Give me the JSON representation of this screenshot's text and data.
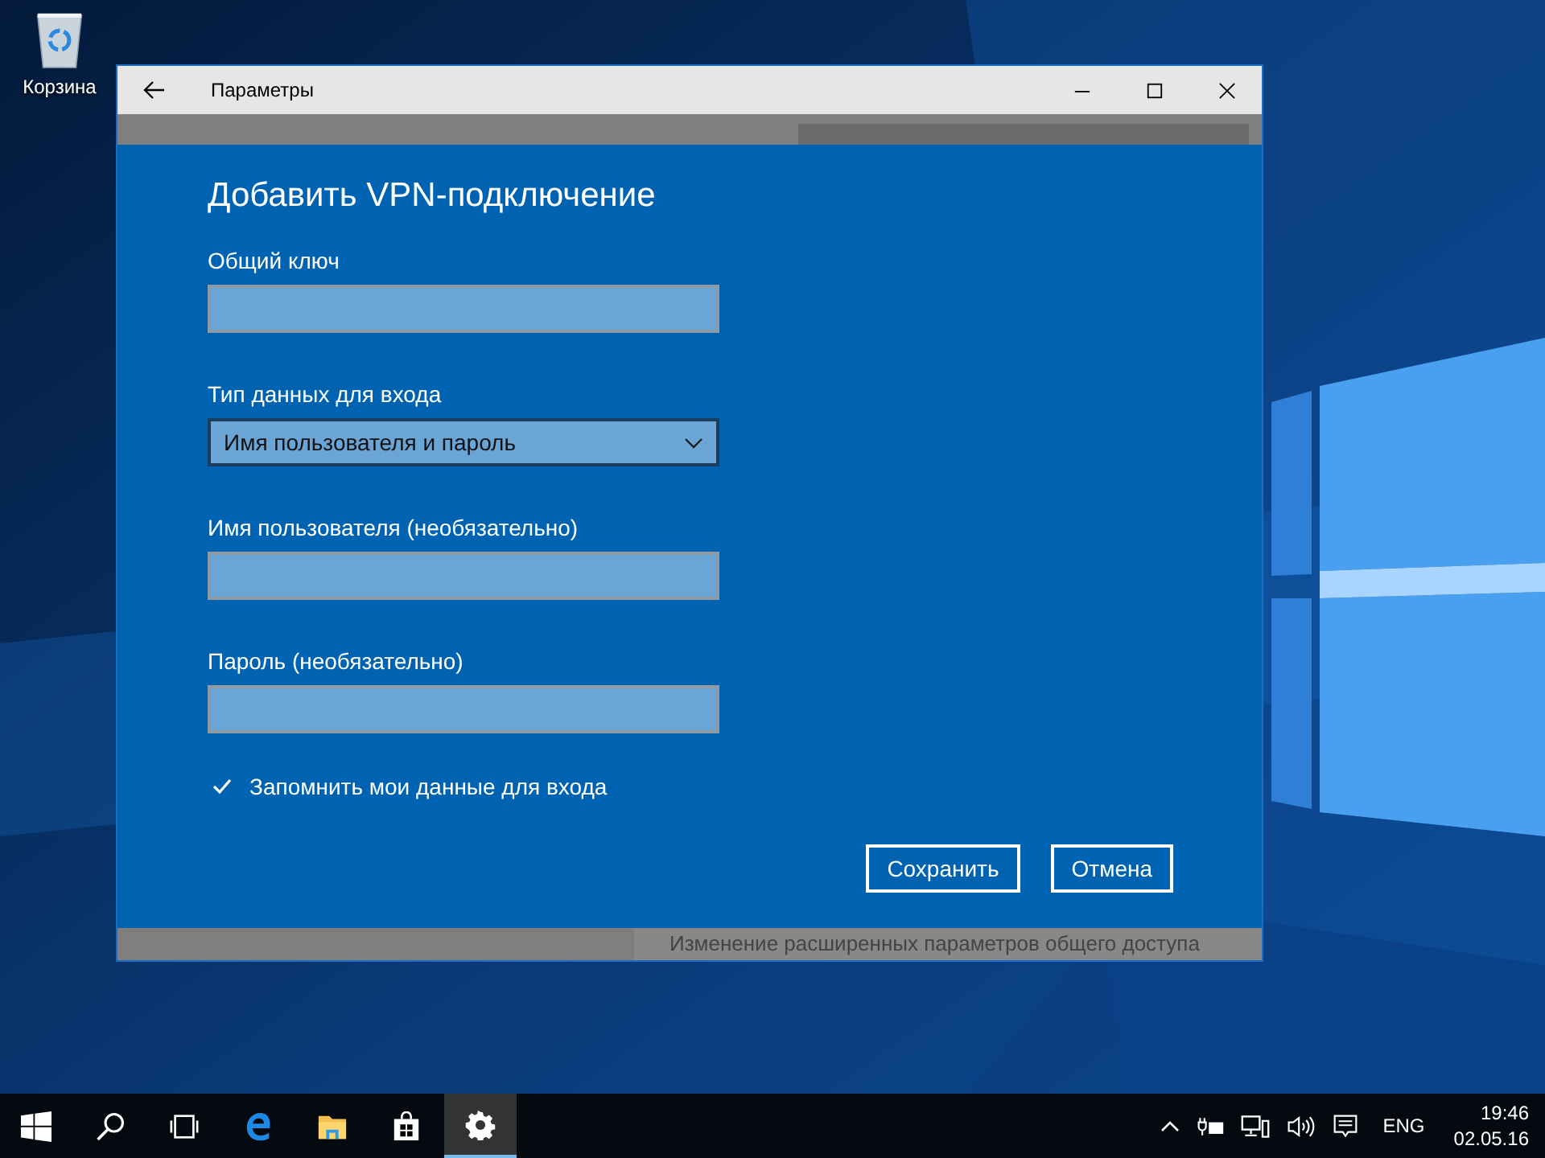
{
  "desktop": {
    "icons": [
      {
        "label": "Корзина"
      }
    ]
  },
  "window": {
    "title": "Параметры",
    "footer_text": "Изменение расширенных параметров общего доступа"
  },
  "dialog": {
    "title": "Добавить VPN-подключение",
    "fields": [
      {
        "kind": "text",
        "label": "Общий ключ"
      },
      {
        "kind": "select",
        "label": "Тип данных для входа",
        "value": "Имя пользователя и пароль"
      },
      {
        "kind": "text",
        "label": "Имя пользователя (необязательно)"
      },
      {
        "kind": "text",
        "label": "Пароль (необязательно)"
      }
    ],
    "checkbox": {
      "label": "Запомнить мои данные для входа",
      "checked": true
    },
    "buttons": [
      {
        "label": "Сохранить"
      },
      {
        "label": "Отмена"
      }
    ]
  },
  "taskbar": {
    "items": [
      {
        "kind": "start",
        "selected": false
      },
      {
        "kind": "search",
        "selected": false
      },
      {
        "kind": "taskview",
        "selected": false
      },
      {
        "kind": "browser",
        "selected": false
      },
      {
        "kind": "folder",
        "selected": false
      },
      {
        "kind": "store",
        "selected": false
      },
      {
        "kind": "settings",
        "selected": true
      }
    ],
    "language": "ENG",
    "time": "19:46",
    "date": "02.05.16"
  }
}
